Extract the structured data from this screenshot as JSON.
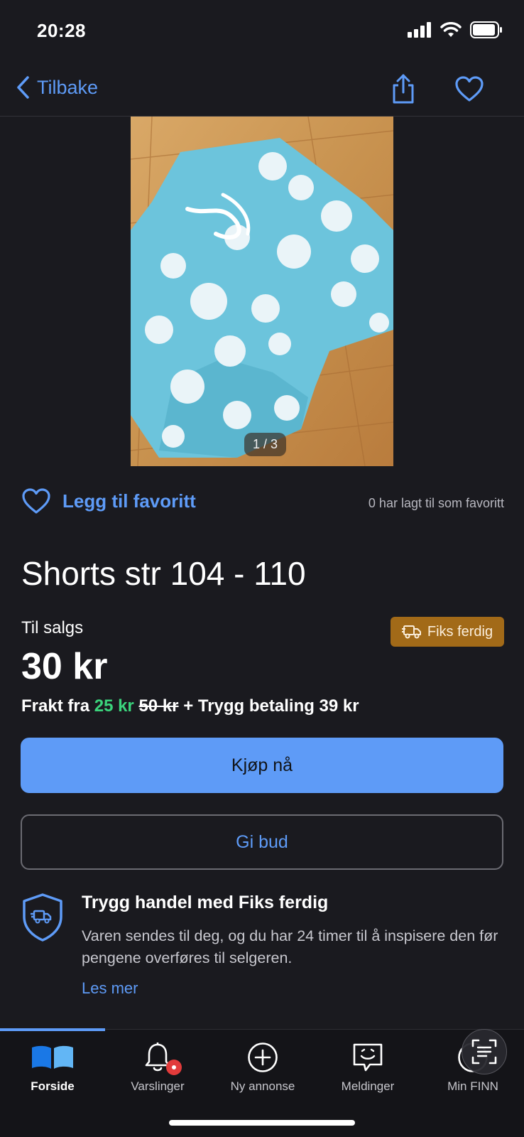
{
  "status_bar": {
    "time": "20:28"
  },
  "nav": {
    "back_label": "Tilbake"
  },
  "listing": {
    "photo_counter": "1 / 3",
    "favorite_label": "Legg til favoritt",
    "favorite_count_text": "0 har lagt til som favoritt",
    "title": "Shorts str 104 - 110",
    "sale_type": "Til salgs",
    "badge_label": "Fiks ferdig",
    "price": "30 kr",
    "shipping": {
      "prefix": "Frakt fra",
      "discounted_price": "25 kr",
      "original_price": "50 kr",
      "suffix": "+ Trygg betaling 39 kr"
    }
  },
  "actions": {
    "buy_label": "Kjøp nå",
    "bid_label": "Gi bud"
  },
  "safe_trade": {
    "title": "Trygg handel med Fiks ferdig",
    "text": "Varen sendes til deg, og du har 24 timer til å inspisere den før pengene overføres til selgeren.",
    "link": "Les mer"
  },
  "tabs": [
    {
      "label": "Forside",
      "icon": "book-icon",
      "active": true
    },
    {
      "label": "Varslinger",
      "icon": "bell-icon",
      "badge": true
    },
    {
      "label": "Ny annonse",
      "icon": "plus-circle-icon"
    },
    {
      "label": "Meldinger",
      "icon": "chat-icon"
    },
    {
      "label": "Min FINN",
      "icon": "person-icon"
    }
  ],
  "colors": {
    "accent": "#5e9bf7",
    "background": "#1a1a1f",
    "badge": "#a26a18",
    "green": "#3bd47c"
  }
}
